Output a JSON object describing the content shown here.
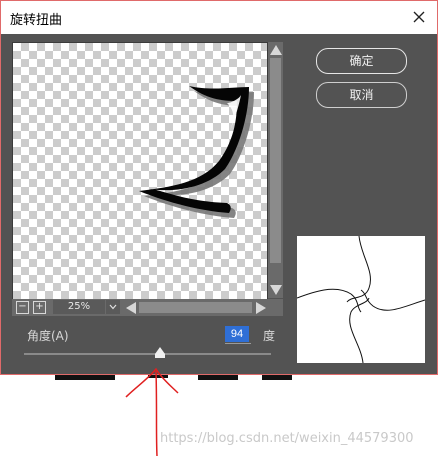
{
  "window": {
    "title": "旋转扭曲",
    "close_icon": "close-icon"
  },
  "buttons": {
    "ok_label": "确定",
    "cancel_label": "取消"
  },
  "preview": {
    "zoom_value": "25%",
    "zoom_out_label": "−",
    "zoom_in_label": "+"
  },
  "angle": {
    "label": "角度(A)",
    "value": "94",
    "unit": "度",
    "slider_fraction": 0.55
  },
  "watermark": {
    "text": "https://blog.csdn.net/weixin_44579300"
  },
  "colors": {
    "dialog_bg": "#535353",
    "dialog_border": "#e06a6a",
    "input_highlight": "#2f6fd6",
    "annotation": "#e02020"
  }
}
